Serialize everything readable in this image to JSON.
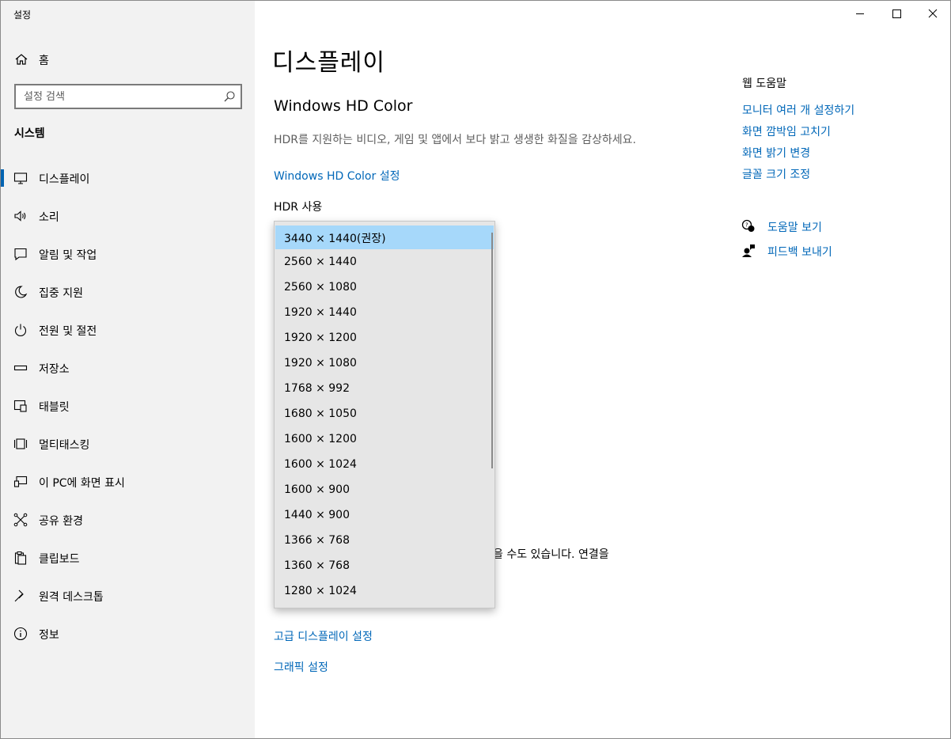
{
  "window": {
    "title": "설정"
  },
  "sidebar": {
    "home_label": "홈",
    "search_placeholder": "설정 검색",
    "section_title": "시스템",
    "items": [
      {
        "label": "디스플레이",
        "icon": "monitor-icon",
        "active": true
      },
      {
        "label": "소리",
        "icon": "speaker-icon"
      },
      {
        "label": "알림 및 작업",
        "icon": "notification-icon"
      },
      {
        "label": "집중 지원",
        "icon": "moon-icon"
      },
      {
        "label": "전원 및 절전",
        "icon": "power-icon"
      },
      {
        "label": "저장소",
        "icon": "storage-icon"
      },
      {
        "label": "태블릿",
        "icon": "tablet-icon"
      },
      {
        "label": "멀티태스킹",
        "icon": "multitasking-icon"
      },
      {
        "label": "이 PC에 화면 표시",
        "icon": "project-icon"
      },
      {
        "label": "공유 환경",
        "icon": "share-icon"
      },
      {
        "label": "클립보드",
        "icon": "clipboard-icon"
      },
      {
        "label": "원격 데스크톱",
        "icon": "remote-desktop-icon"
      },
      {
        "label": "정보",
        "icon": "info-icon"
      }
    ]
  },
  "main": {
    "page_title": "디스플레이",
    "hd_color_heading": "Windows HD Color",
    "hd_color_desc": "HDR를 지원하는 비디오, 게임 및 앱에서 보다 밝고 생생한 화질을 감상하세요.",
    "hd_color_link": "Windows HD Color 설정",
    "hdr_label": "HDR 사용",
    "partial_text": "을 수도 있습니다. 연결을",
    "advanced_link": "고급 디스플레이 설정",
    "graphics_link": "그래픽 설정"
  },
  "resolution_dropdown": {
    "options": [
      "3440 × 1440(권장)",
      "2560 × 1440",
      "2560 × 1080",
      "1920 × 1440",
      "1920 × 1200",
      "1920 × 1080",
      "1768 × 992",
      "1680 × 1050",
      "1600 × 1200",
      "1600 × 1024",
      "1600 × 900",
      "1440 × 900",
      "1366 × 768",
      "1360 × 768",
      "1280 × 1024"
    ],
    "selected_index": 0
  },
  "help": {
    "title": "웹 도움말",
    "links": [
      "모니터 여러 개 설정하기",
      "화면 깜박임 고치기",
      "화면 밝기 변경",
      "글꼴 크기 조정"
    ],
    "get_help": "도움말 보기",
    "feedback": "피드백 보내기"
  }
}
